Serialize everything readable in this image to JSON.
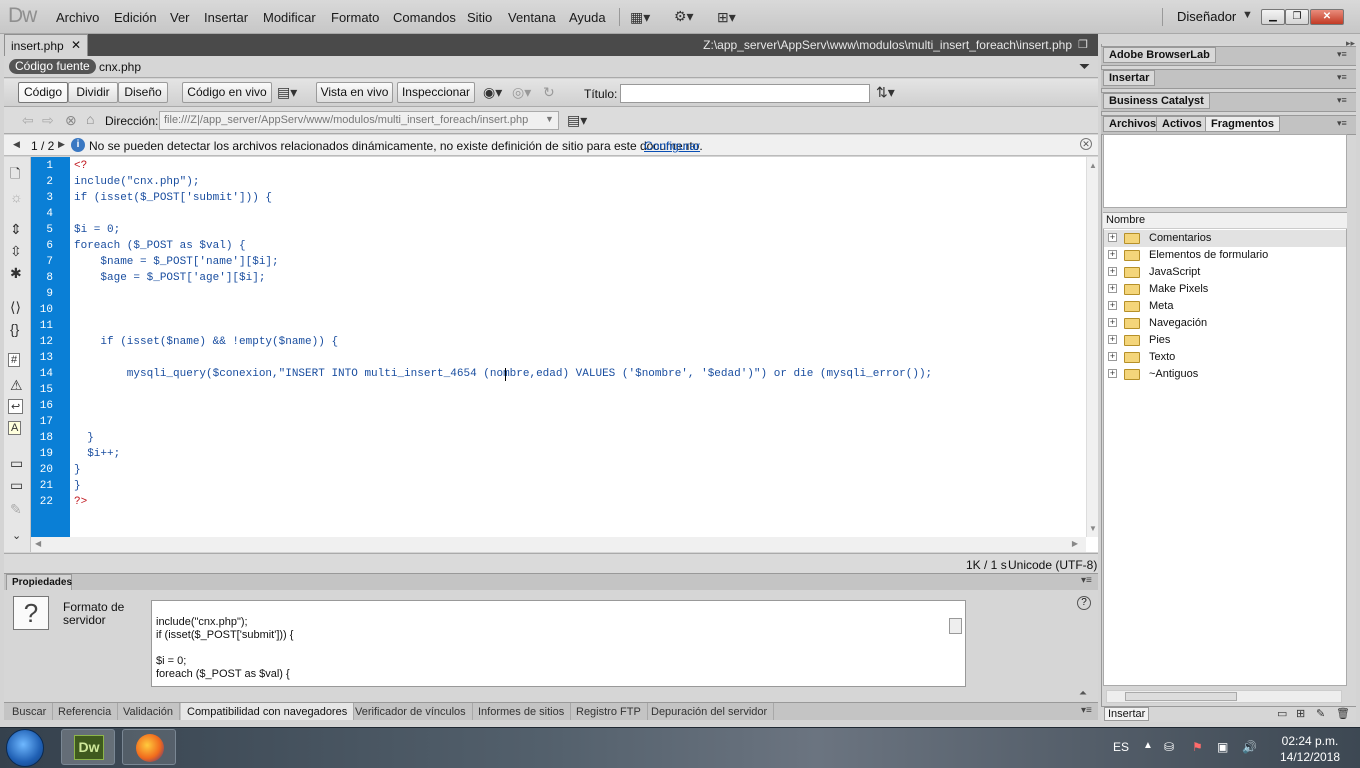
{
  "app": {
    "logo": "Dw",
    "workspace": "Diseñador"
  },
  "menu": [
    "Archivo",
    "Edición",
    "Ver",
    "Insertar",
    "Modificar",
    "Formato",
    "Comandos",
    "Sitio",
    "Ventana",
    "Ayuda"
  ],
  "document": {
    "tab_name": "insert.php",
    "path": "Z:\\app_server\\AppServ\\www\\modulos\\multi_insert_foreach\\insert.php",
    "source_tab": "Código fuente",
    "related_file": "cnx.php"
  },
  "toolbar": {
    "view_code": "Código",
    "view_split": "Dividir",
    "view_design": "Diseño",
    "live_code": "Código en vivo",
    "live_view": "Vista en vivo",
    "inspect": "Inspeccionar",
    "title_label": "Título:",
    "title_value": ""
  },
  "browser_nav": {
    "address_label": "Dirección:",
    "address_value": "file:///Z|/app_server/AppServ/www/modulos/multi_insert_foreach/insert.php"
  },
  "infobar": {
    "pager": "1 / 2",
    "message": "No se pueden detectar los archivos relacionados dinámicamente, no existe definición de sitio para este documento.",
    "link": "Configurar"
  },
  "code_lines": [
    "<?",
    "include(\"cnx.php\");",
    "if (isset($_POST['submit'])) {",
    "",
    "$i = 0;",
    "foreach ($_POST as $val) {",
    "    $name = $_POST['name'][$i];",
    "    $age = $_POST['age'][$i];",
    "",
    "",
    "",
    "    if (isset($name) && !empty($name)) {",
    "",
    "        mysqli_query($conexion,\"INSERT INTO multi_insert_4654 (nombre,edad) VALUES ('$nombre', '$edad')\") or die (mysqli_error());",
    "",
    "",
    "",
    "  }",
    "  $i++;",
    "}",
    "}",
    "?>"
  ],
  "line_numbers": [
    "1",
    "2",
    "3",
    "4",
    "5",
    "6",
    "7",
    "8",
    "9",
    "10",
    "11",
    "12",
    "13",
    "14",
    "15",
    "16",
    "17",
    "18",
    "19",
    "20",
    "21",
    "22"
  ],
  "status": {
    "size": "1K / 1 s",
    "encoding": "Unicode (UTF-8)"
  },
  "properties": {
    "tab": "Propiedades",
    "format_label_1": "Formato de",
    "format_label_2": "servidor",
    "code_preview": "include(\"cnx.php\");\nif (isset($_POST['submit'])) {\n\n$i = 0;\nforeach ($_POST as $val) {"
  },
  "bottom_tabs": [
    "Buscar",
    "Referencia",
    "Validación",
    "Compatibilidad con navegadores",
    "Verificador de vínculos",
    "Informes de sitios",
    "Registro FTP",
    "Depuración del servidor"
  ],
  "right_panels": {
    "browserlab": "Adobe BrowserLab",
    "insert": "Insertar",
    "catalyst": "Business Catalyst",
    "tabs": [
      "Archivos",
      "Activos",
      "Fragmentos"
    ],
    "list_header": "Nombre",
    "folders": [
      "Comentarios",
      "Elementos de formulario",
      "JavaScript",
      "Make Pixels",
      "Meta",
      "Navegación",
      "Pies",
      "Texto",
      "~Antiguos"
    ],
    "insert_button": "Insertar"
  },
  "taskbar": {
    "dw_label": "Dw",
    "lang": "ES",
    "time": "02:24 p.m.",
    "date": "14/12/2018"
  },
  "colors": {
    "gutter": "#0a7fd6",
    "keyword": "#1a4ea0",
    "string": "#c0161d",
    "dw_green": "#3f5a1e"
  }
}
